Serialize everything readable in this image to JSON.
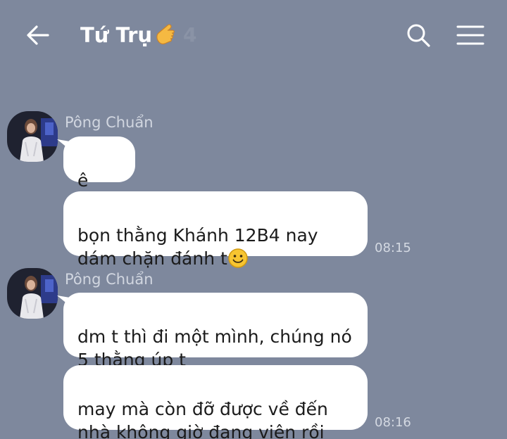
{
  "header": {
    "title": "Tứ Trụ",
    "member_count": "4",
    "title_emoji": "finger-point-emoji",
    "icons": {
      "back": "back-arrow-icon",
      "search": "search-icon",
      "menu": "hamburger-menu-icon"
    }
  },
  "colors": {
    "background": "#7e889d",
    "bubble": "#ffffff",
    "title": "#ffffff",
    "sender": "#d1d6e0",
    "timestamp": "#d4d9e2"
  },
  "messages": [
    {
      "sender": "Pông Chuẩn",
      "bubbles": [
        {
          "text": "ê dm"
        },
        {
          "text": "bọn thằng Khánh 12B4 nay\ndám chặn đánh t",
          "emoji": "smiley-emoji"
        }
      ],
      "time": "08:15"
    },
    {
      "sender": "Pông Chuẩn",
      "bubbles": [
        {
          "text": "dm t thì đi một mình, chúng nó\n5 thằng úp t"
        },
        {
          "text": "may mà còn đỡ được về đến\nnhà không giờ đang viện rồi"
        }
      ],
      "time": "08:16"
    }
  ]
}
